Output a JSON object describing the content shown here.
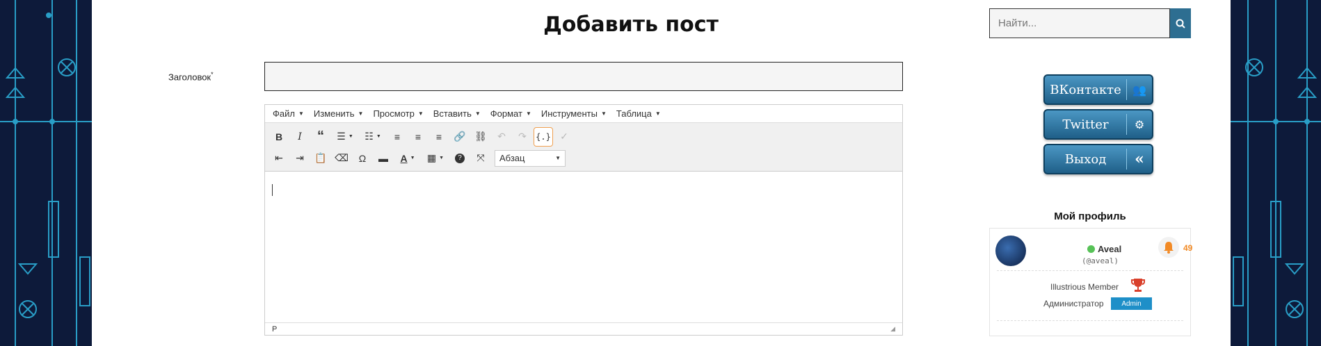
{
  "page_title": "Добавить пост",
  "form": {
    "title_label": "Заголовок",
    "required_mark": "*",
    "title_value": ""
  },
  "editor": {
    "menus": [
      "Файл",
      "Изменить",
      "Просмотр",
      "Вставить",
      "Формат",
      "Инструменты",
      "Таблица"
    ],
    "format_select_value": "Абзац",
    "statusbar_path": "P",
    "toolbar_row1": [
      "bold-icon",
      "italic-icon",
      "blockquote-icon",
      "bullet-list-icon",
      "numbered-list-icon",
      "align-left-icon",
      "align-center-icon",
      "align-right-icon",
      "link-icon",
      "unlink-icon",
      "undo-icon",
      "redo-icon",
      "code-icon",
      "spellcheck-icon"
    ],
    "toolbar_row2": [
      "outdent-icon",
      "indent-icon",
      "paste-text-icon",
      "clear-format-icon",
      "special-char-icon",
      "hr-icon",
      "text-color-icon",
      "table-icon",
      "help-icon",
      "fullscreen-icon"
    ]
  },
  "sidebar": {
    "search_placeholder": "Найти...",
    "social_buttons": [
      {
        "label": "ВКонтакте",
        "icon": "group-icon"
      },
      {
        "label": "Twitter",
        "icon": "gears-icon"
      },
      {
        "label": "Выход",
        "icon": "double-chevron-left-icon"
      }
    ],
    "profile": {
      "title": "Мой профиль",
      "username": "Aveal",
      "handle": "(@aveal)",
      "notifications": "49",
      "rank": "Illustrious Member",
      "role": "Администратор",
      "role_badge": "Admin"
    }
  },
  "colors": {
    "accent": "#2d6e91",
    "notification": "#f28a25",
    "online": "#57c257",
    "badge": "#1e8fc8",
    "active_tool_border": "#f0a050"
  }
}
